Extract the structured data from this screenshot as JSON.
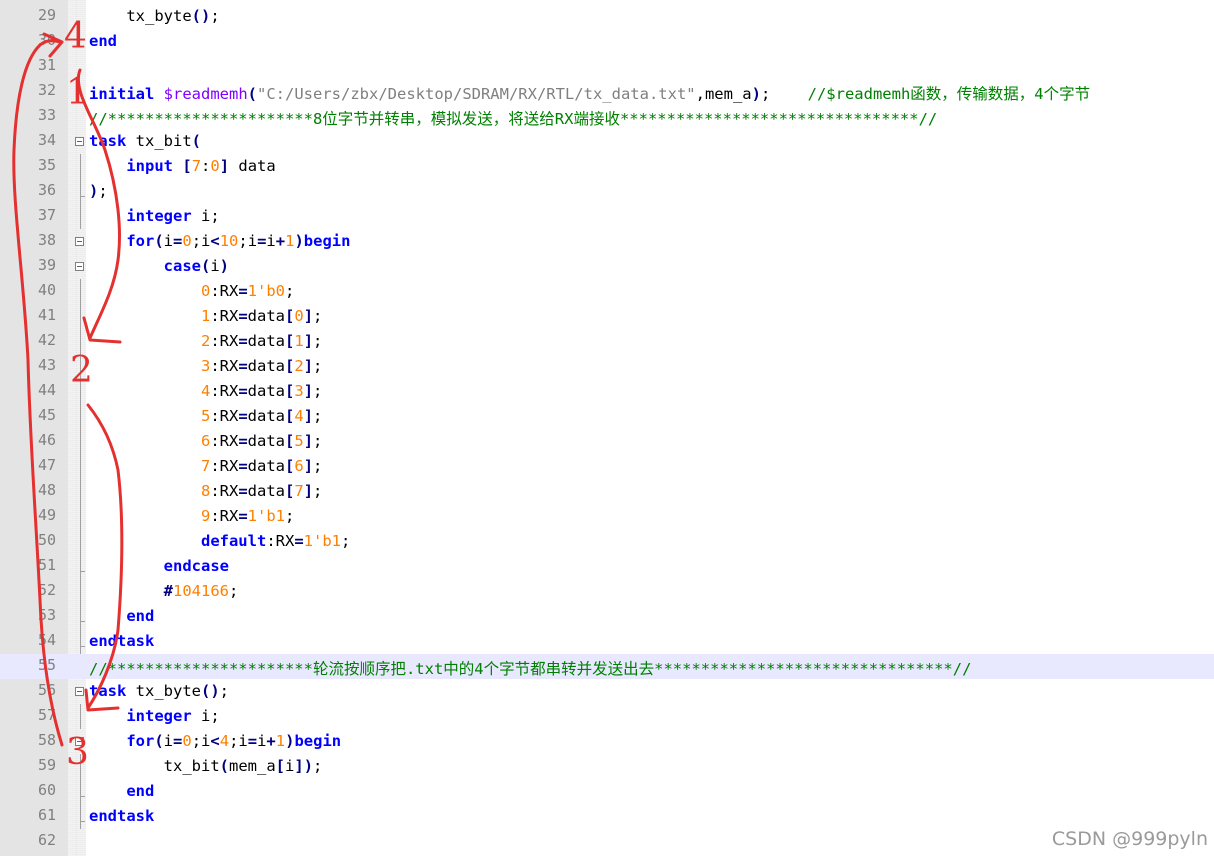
{
  "editor": {
    "lines": [
      {
        "n": "29",
        "tokens": [
          [
            "plain",
            "    tx_byte"
          ],
          [
            "op",
            "()"
          ],
          [
            "plain",
            ";"
          ]
        ]
      },
      {
        "n": "30",
        "tokens": [
          [
            "kw",
            "end"
          ]
        ]
      },
      {
        "n": "31",
        "tokens": []
      },
      {
        "n": "32",
        "tokens": [
          [
            "kw",
            "initial"
          ],
          [
            "plain",
            " "
          ],
          [
            "sys",
            "$readmemh"
          ],
          [
            "op",
            "("
          ],
          [
            "str",
            "\"C:/Users/zbx/Desktop/SDRAM/RX/RTL/tx_data.txt\""
          ],
          [
            "plain",
            ",mem_a"
          ],
          [
            "op",
            ")"
          ],
          [
            "plain",
            ";    "
          ],
          [
            "cmt",
            "//$readmemh函数，传输数据，4个字节"
          ]
        ]
      },
      {
        "n": "33",
        "tokens": [
          [
            "cmt",
            "//**********************8位字节并转串，模拟发送，将送给RX端接收********************************//"
          ]
        ]
      },
      {
        "n": "34",
        "fold": "open",
        "tokens": [
          [
            "kw",
            "task"
          ],
          [
            "plain",
            " tx_bit"
          ],
          [
            "op",
            "("
          ]
        ]
      },
      {
        "n": "35",
        "guide": true,
        "tokens": [
          [
            "plain",
            "    "
          ],
          [
            "kw",
            "input"
          ],
          [
            "plain",
            " "
          ],
          [
            "op",
            "["
          ],
          [
            "num",
            "7"
          ],
          [
            "plain",
            ":"
          ],
          [
            "num",
            "0"
          ],
          [
            "op",
            "]"
          ],
          [
            "plain",
            " data"
          ]
        ]
      },
      {
        "n": "36",
        "guide": "end",
        "tokens": [
          [
            "op",
            ")"
          ],
          [
            "plain",
            ";"
          ]
        ]
      },
      {
        "n": "37",
        "guide": true,
        "tokens": [
          [
            "plain",
            "    "
          ],
          [
            "kw",
            "integer"
          ],
          [
            "plain",
            " i;"
          ]
        ]
      },
      {
        "n": "38",
        "fold": "open",
        "tokens": [
          [
            "plain",
            "    "
          ],
          [
            "kw",
            "for"
          ],
          [
            "op",
            "("
          ],
          [
            "plain",
            "i"
          ],
          [
            "op",
            "="
          ],
          [
            "num",
            "0"
          ],
          [
            "plain",
            ";i"
          ],
          [
            "op",
            "<"
          ],
          [
            "num",
            "10"
          ],
          [
            "plain",
            ";i"
          ],
          [
            "op",
            "="
          ],
          [
            "plain",
            "i"
          ],
          [
            "op",
            "+"
          ],
          [
            "num",
            "1"
          ],
          [
            "op",
            ")"
          ],
          [
            "kw",
            "begin"
          ]
        ]
      },
      {
        "n": "39",
        "fold": "open",
        "tokens": [
          [
            "plain",
            "        "
          ],
          [
            "kw",
            "case"
          ],
          [
            "op",
            "("
          ],
          [
            "plain",
            "i"
          ],
          [
            "op",
            ")"
          ]
        ]
      },
      {
        "n": "40",
        "guide": true,
        "tokens": [
          [
            "plain",
            "            "
          ],
          [
            "num",
            "0"
          ],
          [
            "plain",
            ":RX"
          ],
          [
            "op",
            "="
          ],
          [
            "num",
            "1'b0"
          ],
          [
            "plain",
            ";"
          ]
        ]
      },
      {
        "n": "41",
        "guide": true,
        "tokens": [
          [
            "plain",
            "            "
          ],
          [
            "num",
            "1"
          ],
          [
            "plain",
            ":RX"
          ],
          [
            "op",
            "="
          ],
          [
            "plain",
            "data"
          ],
          [
            "op",
            "["
          ],
          [
            "num",
            "0"
          ],
          [
            "op",
            "]"
          ],
          [
            "plain",
            ";"
          ]
        ]
      },
      {
        "n": "42",
        "guide": true,
        "tokens": [
          [
            "plain",
            "            "
          ],
          [
            "num",
            "2"
          ],
          [
            "plain",
            ":RX"
          ],
          [
            "op",
            "="
          ],
          [
            "plain",
            "data"
          ],
          [
            "op",
            "["
          ],
          [
            "num",
            "1"
          ],
          [
            "op",
            "]"
          ],
          [
            "plain",
            ";"
          ]
        ]
      },
      {
        "n": "43",
        "guide": true,
        "tokens": [
          [
            "plain",
            "            "
          ],
          [
            "num",
            "3"
          ],
          [
            "plain",
            ":RX"
          ],
          [
            "op",
            "="
          ],
          [
            "plain",
            "data"
          ],
          [
            "op",
            "["
          ],
          [
            "num",
            "2"
          ],
          [
            "op",
            "]"
          ],
          [
            "plain",
            ";"
          ]
        ]
      },
      {
        "n": "44",
        "guide": true,
        "tokens": [
          [
            "plain",
            "            "
          ],
          [
            "num",
            "4"
          ],
          [
            "plain",
            ":RX"
          ],
          [
            "op",
            "="
          ],
          [
            "plain",
            "data"
          ],
          [
            "op",
            "["
          ],
          [
            "num",
            "3"
          ],
          [
            "op",
            "]"
          ],
          [
            "plain",
            ";"
          ]
        ]
      },
      {
        "n": "45",
        "guide": true,
        "tokens": [
          [
            "plain",
            "            "
          ],
          [
            "num",
            "5"
          ],
          [
            "plain",
            ":RX"
          ],
          [
            "op",
            "="
          ],
          [
            "plain",
            "data"
          ],
          [
            "op",
            "["
          ],
          [
            "num",
            "4"
          ],
          [
            "op",
            "]"
          ],
          [
            "plain",
            ";"
          ]
        ]
      },
      {
        "n": "46",
        "guide": true,
        "tokens": [
          [
            "plain",
            "            "
          ],
          [
            "num",
            "6"
          ],
          [
            "plain",
            ":RX"
          ],
          [
            "op",
            "="
          ],
          [
            "plain",
            "data"
          ],
          [
            "op",
            "["
          ],
          [
            "num",
            "5"
          ],
          [
            "op",
            "]"
          ],
          [
            "plain",
            ";"
          ]
        ]
      },
      {
        "n": "47",
        "guide": true,
        "tokens": [
          [
            "plain",
            "            "
          ],
          [
            "num",
            "7"
          ],
          [
            "plain",
            ":RX"
          ],
          [
            "op",
            "="
          ],
          [
            "plain",
            "data"
          ],
          [
            "op",
            "["
          ],
          [
            "num",
            "6"
          ],
          [
            "op",
            "]"
          ],
          [
            "plain",
            ";"
          ]
        ]
      },
      {
        "n": "48",
        "guide": true,
        "tokens": [
          [
            "plain",
            "            "
          ],
          [
            "num",
            "8"
          ],
          [
            "plain",
            ":RX"
          ],
          [
            "op",
            "="
          ],
          [
            "plain",
            "data"
          ],
          [
            "op",
            "["
          ],
          [
            "num",
            "7"
          ],
          [
            "op",
            "]"
          ],
          [
            "plain",
            ";"
          ]
        ]
      },
      {
        "n": "49",
        "guide": true,
        "tokens": [
          [
            "plain",
            "            "
          ],
          [
            "num",
            "9"
          ],
          [
            "plain",
            ":RX"
          ],
          [
            "op",
            "="
          ],
          [
            "num",
            "1'b1"
          ],
          [
            "plain",
            ";"
          ]
        ]
      },
      {
        "n": "50",
        "guide": true,
        "tokens": [
          [
            "plain",
            "            "
          ],
          [
            "kw",
            "default"
          ],
          [
            "plain",
            ":RX"
          ],
          [
            "op",
            "="
          ],
          [
            "num",
            "1'b1"
          ],
          [
            "plain",
            ";"
          ]
        ]
      },
      {
        "n": "51",
        "guide": "end",
        "tokens": [
          [
            "plain",
            "        "
          ],
          [
            "kw",
            "endcase"
          ]
        ]
      },
      {
        "n": "52",
        "guide": true,
        "tokens": [
          [
            "plain",
            "        "
          ],
          [
            "op",
            "#"
          ],
          [
            "num",
            "104166"
          ],
          [
            "plain",
            ";"
          ]
        ]
      },
      {
        "n": "53",
        "guide": "end",
        "tokens": [
          [
            "plain",
            "    "
          ],
          [
            "kw",
            "end"
          ]
        ]
      },
      {
        "n": "54",
        "guide": "end",
        "tokens": [
          [
            "kw",
            "endtask"
          ]
        ]
      },
      {
        "n": "55",
        "hl": true,
        "tokens": [
          [
            "cmt",
            "//**********************轮流按顺序把.txt中的4个字节都串转并发送出去********************************//"
          ]
        ]
      },
      {
        "n": "56",
        "fold": "open",
        "tokens": [
          [
            "kw",
            "task"
          ],
          [
            "plain",
            " tx_byte"
          ],
          [
            "op",
            "()"
          ],
          [
            "plain",
            ";"
          ]
        ]
      },
      {
        "n": "57",
        "guide": true,
        "tokens": [
          [
            "plain",
            "    "
          ],
          [
            "kw",
            "integer"
          ],
          [
            "plain",
            " i;"
          ]
        ]
      },
      {
        "n": "58",
        "fold": "open",
        "tokens": [
          [
            "plain",
            "    "
          ],
          [
            "kw",
            "for"
          ],
          [
            "op",
            "("
          ],
          [
            "plain",
            "i"
          ],
          [
            "op",
            "="
          ],
          [
            "num",
            "0"
          ],
          [
            "plain",
            ";i"
          ],
          [
            "op",
            "<"
          ],
          [
            "num",
            "4"
          ],
          [
            "plain",
            ";i"
          ],
          [
            "op",
            "="
          ],
          [
            "plain",
            "i"
          ],
          [
            "op",
            "+"
          ],
          [
            "num",
            "1"
          ],
          [
            "op",
            ")"
          ],
          [
            "kw",
            "begin"
          ]
        ]
      },
      {
        "n": "59",
        "guide": true,
        "tokens": [
          [
            "plain",
            "        tx_bit"
          ],
          [
            "op",
            "("
          ],
          [
            "plain",
            "mem_a"
          ],
          [
            "op",
            "["
          ],
          [
            "plain",
            "i"
          ],
          [
            "op",
            "])"
          ],
          [
            "plain",
            ";"
          ]
        ]
      },
      {
        "n": "60",
        "guide": "end",
        "tokens": [
          [
            "plain",
            "    "
          ],
          [
            "kw",
            "end"
          ]
        ]
      },
      {
        "n": "61",
        "guide": "end",
        "tokens": [
          [
            "kw",
            "endtask"
          ]
        ]
      },
      {
        "n": "62",
        "tokens": []
      }
    ]
  },
  "annotations": {
    "color": "#e53030",
    "labels": [
      "1",
      "2",
      "3",
      "4"
    ]
  },
  "watermark": "CSDN @999pyln"
}
